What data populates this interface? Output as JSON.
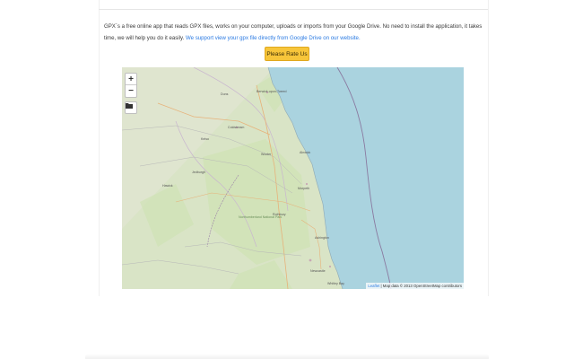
{
  "intro": {
    "text": "GPX`s a free online app that reads GPX files, works on your computer, uploads or imports from your Google Drive. No need to install the application, it takes time, we will help you do it easily. ",
    "link": "We support view your gpx file directly from Google Drive on our website."
  },
  "rate_button": {
    "label": "Please Rate Us"
  },
  "map": {
    "zoom_in": "+",
    "zoom_out": "−",
    "attribution_link": "Leaflet",
    "attribution_text": " | Map data © 2013 OpenStreetMap contributors",
    "colors": {
      "land": "#dfe5cf",
      "sea": "#aad3df",
      "forest": "#cfe2b5",
      "coast": "#a08fb0"
    },
    "places": [
      "Berwick-upon-Tweed",
      "Duns",
      "Coldstream",
      "Kelso",
      "Wooler",
      "Alnwick",
      "Jedburgh",
      "Hawick",
      "Rothbury",
      "Northumberland National Park",
      "Morpeth",
      "Ashington",
      "Newcastle",
      "Whitley Bay"
    ]
  }
}
